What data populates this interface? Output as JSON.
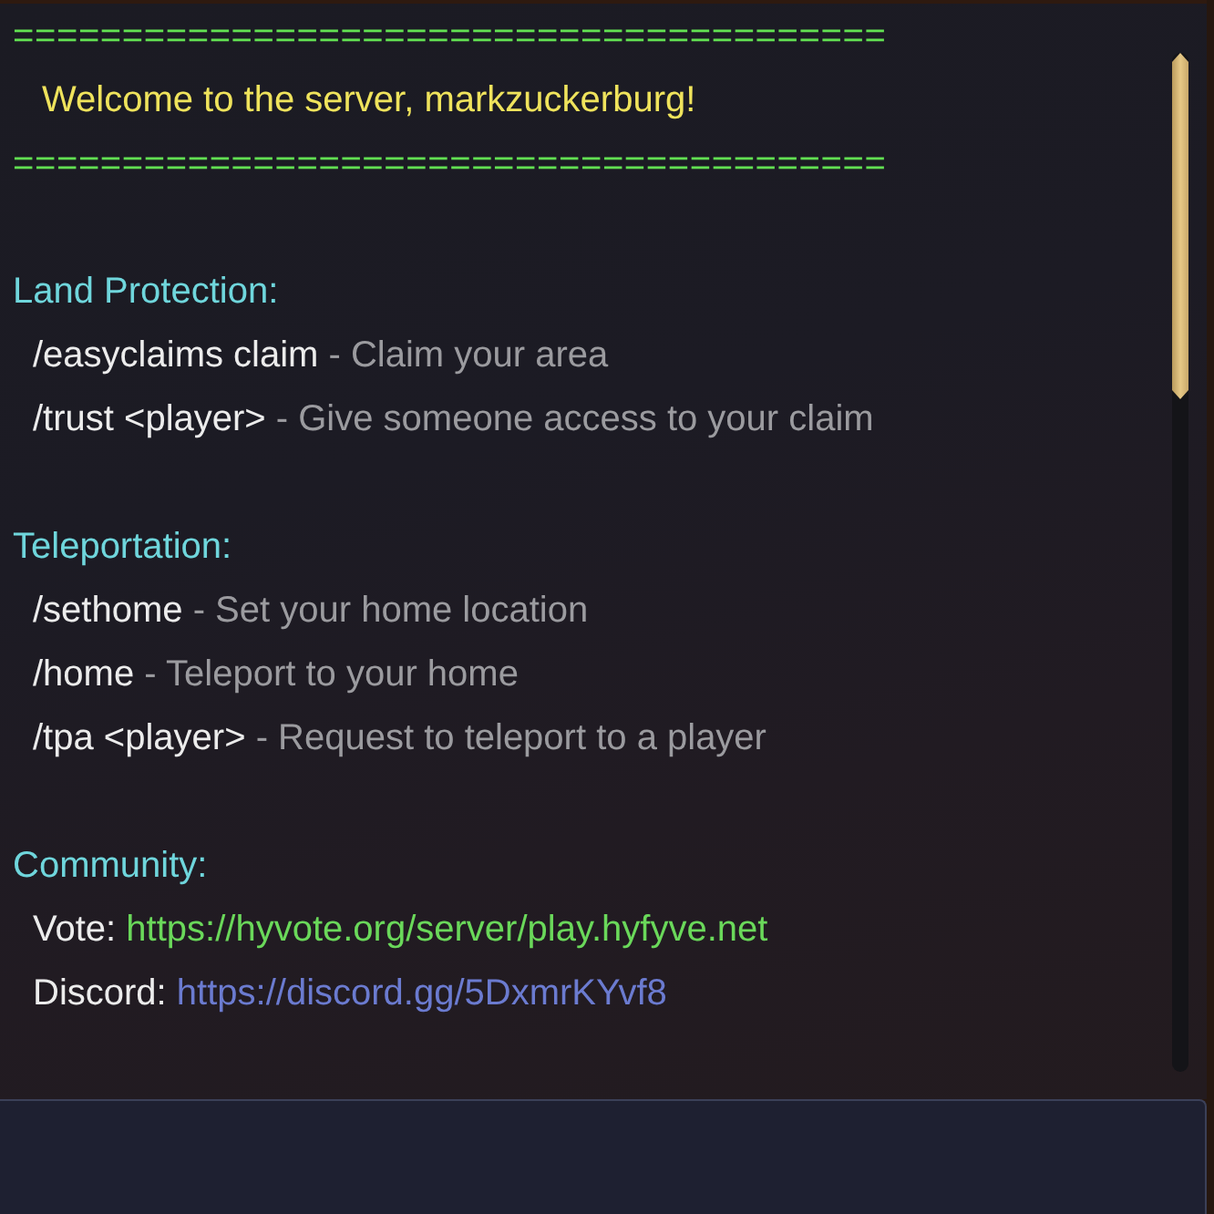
{
  "chat": {
    "banner": {
      "rule_top": "========================================",
      "greeting": "Welcome to the server, markzuckerburg!",
      "rule_bottom": "========================================"
    },
    "sections": [
      {
        "heading": "Land Protection:",
        "entries": [
          {
            "kind": "command",
            "command": "/easyclaims claim",
            "description": "- Claim your area"
          },
          {
            "kind": "command",
            "command": "/trust <player>",
            "description": "- Give someone access to your claim"
          }
        ]
      },
      {
        "heading": "Teleportation:",
        "entries": [
          {
            "kind": "command",
            "command": "/sethome",
            "description": "- Set your home location"
          },
          {
            "kind": "command",
            "command": "/home",
            "description": "- Teleport to your home"
          },
          {
            "kind": "command",
            "command": "/tpa <player>",
            "description": "- Request to teleport to a player"
          }
        ]
      },
      {
        "heading": "Community:",
        "entries": [
          {
            "kind": "link",
            "label": "Vote:",
            "url": "https://hyvote.org/server/play.hyfyve.net",
            "color": "#6ad85a"
          },
          {
            "kind": "link",
            "label": "Discord:",
            "url": "https://discord.gg/5DxmrKYvf8",
            "color": "#6b7bd0"
          }
        ]
      }
    ]
  }
}
